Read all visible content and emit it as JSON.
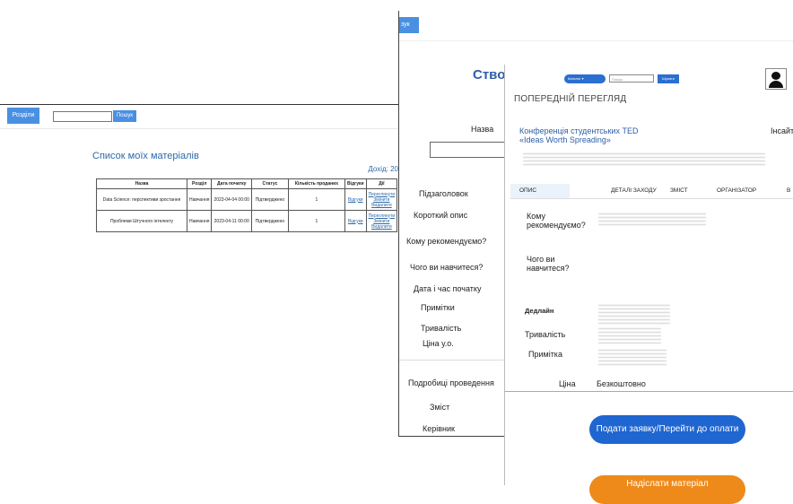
{
  "my_materials": {
    "sections_label": "Розділи",
    "search_label": "Пошук",
    "title": "Список моїх матеріалів",
    "income": "Дохід: 20",
    "columns": [
      "Назва",
      "Розділ",
      "Дата початку",
      "Статус",
      "Кількість проданих",
      "Відгуки",
      "Дії"
    ],
    "rows": [
      {
        "name": "Data Science: перспективи зростання",
        "section": "Навчання",
        "date": "2023-04-04 00:00",
        "status": "Підтверджено",
        "sold": "1",
        "reviews": "Відгуки",
        "actions": [
          "Переглянути",
          "Змінити",
          "Видалити"
        ]
      },
      {
        "name": "Проблеми Штучного інтелекту",
        "section": "Навчання",
        "date": "2023-04-11 00:00",
        "status": "Підтверджено",
        "sold": "1",
        "reviews": "Відгуки",
        "actions": [
          "Переглянути",
          "Змінити",
          "Видалити"
        ]
      }
    ]
  },
  "create_material": {
    "login_label": "зук",
    "title": "Ство",
    "labels": {
      "name": "Назва",
      "subtitle": "Підзаголовок",
      "short_desc": "Короткий опис",
      "recommend": "Кому рекомендуємо?",
      "learn": "Чого ви навчитеся?",
      "start": "Дата і час початку",
      "notes": "Примітки",
      "duration": "Тривалість",
      "price": "Ціна у.о.",
      "details": "Подробиці проведення",
      "content": "Зміст",
      "manager": "Керівник"
    }
  },
  "preview": {
    "catalog_label": "Каталог",
    "search_placeholder": "Пошук",
    "search_label": "Шукати",
    "title": "ПОПЕРЕДНІЙ ПЕРЕГЛЯД",
    "conf_title": "Конференція студентських TED «Ideas Worth Spreading»",
    "insight": "Інсайт",
    "tabs": [
      "ОПИС",
      "ДЕТАЛІ ЗАХОДУ",
      "ЗМІСТ",
      "ОРГАНІЗАТОР",
      "В"
    ],
    "labels": {
      "recommend": "Кому рекомендуємо?",
      "learn": "Чого ви навчитеся?",
      "deadline": "Дедлайн",
      "duration": "Тривалість",
      "note": "Примітка",
      "price": "Ціна"
    },
    "price_value": "Безкоштовно",
    "apply_button": "Подати заявку/Перейти до оплати",
    "send_button": "Надіслати матеріал"
  }
}
